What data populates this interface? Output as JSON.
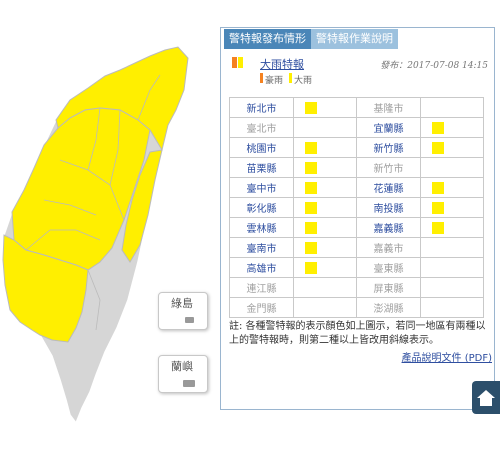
{
  "map": {
    "island_labels": [
      "綠島",
      "蘭嶼"
    ],
    "warning_color": "#ffef00",
    "land_color": "#d6d6d6"
  },
  "panel": {
    "tabs": [
      {
        "label": "警特報發布情形",
        "active": true
      },
      {
        "label": "警特報作業說明",
        "active": false
      }
    ],
    "warning_title": "大雨特報",
    "publish_date": "發布：2017-07-08 14:15",
    "legend": [
      {
        "label": "豪雨",
        "color": "#f58220"
      },
      {
        "label": "大雨",
        "color": "#ffef00"
      }
    ],
    "counties": [
      {
        "name": "新北市",
        "warned": true
      },
      {
        "name": "基隆市",
        "warned": false
      },
      {
        "name": "臺北市",
        "warned": false
      },
      {
        "name": "宜蘭縣",
        "warned": true
      },
      {
        "name": "桃園市",
        "warned": true
      },
      {
        "name": "新竹縣",
        "warned": true
      },
      {
        "name": "苗栗縣",
        "warned": true
      },
      {
        "name": "新竹市",
        "warned": false
      },
      {
        "name": "臺中市",
        "warned": true
      },
      {
        "name": "花蓮縣",
        "warned": true
      },
      {
        "name": "彰化縣",
        "warned": true
      },
      {
        "name": "南投縣",
        "warned": true
      },
      {
        "name": "雲林縣",
        "warned": true
      },
      {
        "name": "嘉義縣",
        "warned": true
      },
      {
        "name": "臺南市",
        "warned": true
      },
      {
        "name": "嘉義市",
        "warned": false
      },
      {
        "name": "高雄市",
        "warned": true
      },
      {
        "name": "臺東縣",
        "warned": false
      },
      {
        "name": "連江縣",
        "warned": false
      },
      {
        "name": "屏東縣",
        "warned": false
      },
      {
        "name": "金門縣",
        "warned": false
      },
      {
        "name": "澎湖縣",
        "warned": false
      }
    ],
    "note": "註: 各種警特報的表示顏色如上圖示，若同一地區有兩種以上的警特報時，則第二種以上皆改用斜線表示。",
    "doc_link": "產品說明文件 (PDF)"
  },
  "home_button_icon": "home-icon"
}
